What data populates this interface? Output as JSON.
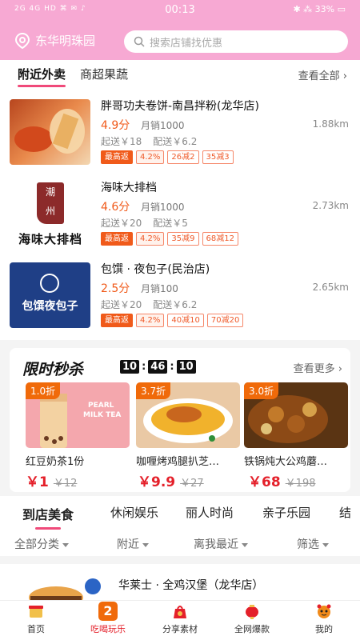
{
  "status_bar": {
    "left": "2G 4G HD ⌘ ✉ ♪",
    "time": "00:13",
    "right": "✱ ⁂ 33% ▭"
  },
  "header": {
    "location": "东华明珠园",
    "search_placeholder": "搜索店铺找优惠"
  },
  "delivery": {
    "tabs": [
      "附近外卖",
      "商超果蔬"
    ],
    "see_all": "查看全部",
    "stores": [
      {
        "name": "胖哥功夫卷饼-南昌拌粉(龙华店)",
        "rating": "4.9分",
        "monthly": "月销1000",
        "distance": "1.88km",
        "min_order": "起送￥18",
        "delivery_fee": "配送￥6.2",
        "tags": [
          "最高返",
          "4.2%",
          "26减2",
          "35减3"
        ]
      },
      {
        "name": "海味大排档",
        "rating": "4.6分",
        "monthly": "月销1000",
        "distance": "2.73km",
        "min_order": "起送￥20",
        "delivery_fee": "配送￥5",
        "tags": [
          "最高返",
          "4.2%",
          "35减9",
          "68减12"
        ],
        "logo_top": "潮",
        "logo_mid": "州",
        "logo_bottom": "海味大排档"
      },
      {
        "name": "包馔 · 夜包子(民治店)",
        "rating": "2.5分",
        "monthly": "月销100",
        "distance": "2.65km",
        "min_order": "起送￥20",
        "delivery_fee": "配送￥6.2",
        "tags": [
          "最高返",
          "4.2%",
          "40减10",
          "70减20"
        ],
        "logo_text": "包馔夜包子"
      }
    ]
  },
  "flash_sale": {
    "title": "限时秒杀",
    "timer": [
      "10",
      "46",
      "10"
    ],
    "more": "查看更多",
    "deals": [
      {
        "badge": "1.0折",
        "name": "红豆奶茶1份",
        "price": "￥1",
        "orig": "￥12",
        "label_1": "PEARL",
        "label_2": "MILK TEA"
      },
      {
        "badge": "3.7折",
        "name": "咖喱烤鸡腿扒芝…",
        "price": "￥9.9",
        "orig": "￥27"
      },
      {
        "badge": "3.0折",
        "name": "铁锅炖大公鸡蘑…",
        "price": "￥68",
        "orig": "￥198"
      }
    ]
  },
  "category_tabs": [
    "到店美食",
    "休闲娱乐",
    "丽人时尚",
    "亲子乐园",
    "结"
  ],
  "filters": [
    "全部分类",
    "附近",
    "离我最近",
    "筛选"
  ],
  "shop_preview": {
    "name": "华莱士 · 全鸡汉堡（龙华店）"
  },
  "bottom_nav": [
    {
      "label": "首页",
      "icon": "home-icon"
    },
    {
      "label": "吃喝玩乐",
      "icon": "number-2-icon",
      "badge": "2"
    },
    {
      "label": "分享素材",
      "icon": "gift-bag-icon"
    },
    {
      "label": "全网爆款",
      "icon": "lantern-icon"
    },
    {
      "label": "我的",
      "icon": "tiger-icon"
    }
  ],
  "colors": {
    "header": "#f7a9d3",
    "accent": "#e4202a",
    "orange": "#f05a1a",
    "tab_indicator": "#f04a7a"
  }
}
